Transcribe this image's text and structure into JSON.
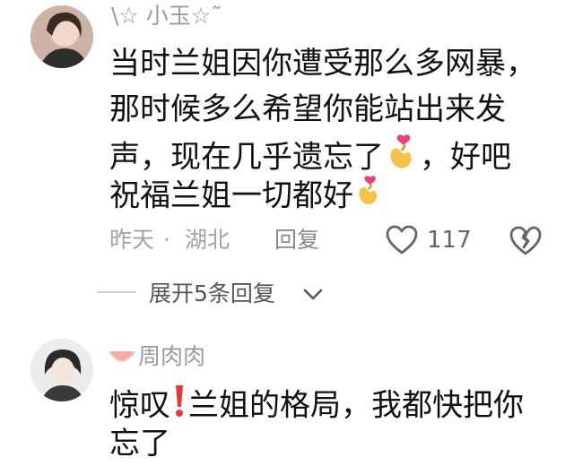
{
  "comments": [
    {
      "username": "\\☆ 小玉☆˜",
      "lines": [
        "当时兰姐因你遭受那么多网暴，",
        "那时候多么希望你能站出来发",
        "声，现在几乎遗忘了",
        "，好吧",
        "祝福兰姐一切都好"
      ],
      "time": "昨天",
      "location": "湖北",
      "reply_label": "回复",
      "likes": "117"
    },
    {
      "username": "周肉肉",
      "lines": [
        "惊叹",
        "兰姐的格局，我都快把你",
        "忘了"
      ]
    }
  ],
  "expand_replies_label": "展开5条回复",
  "colors": {
    "meta": "#a3a3a3",
    "text": "#111111",
    "accent_red": "#e33b3b"
  },
  "icons": [
    "heart-hand-emoji-icon",
    "heart-outline-icon",
    "broken-heart-icon",
    "chevron-down-icon",
    "exclamation-emoji-icon",
    "watermelon-icon"
  ]
}
